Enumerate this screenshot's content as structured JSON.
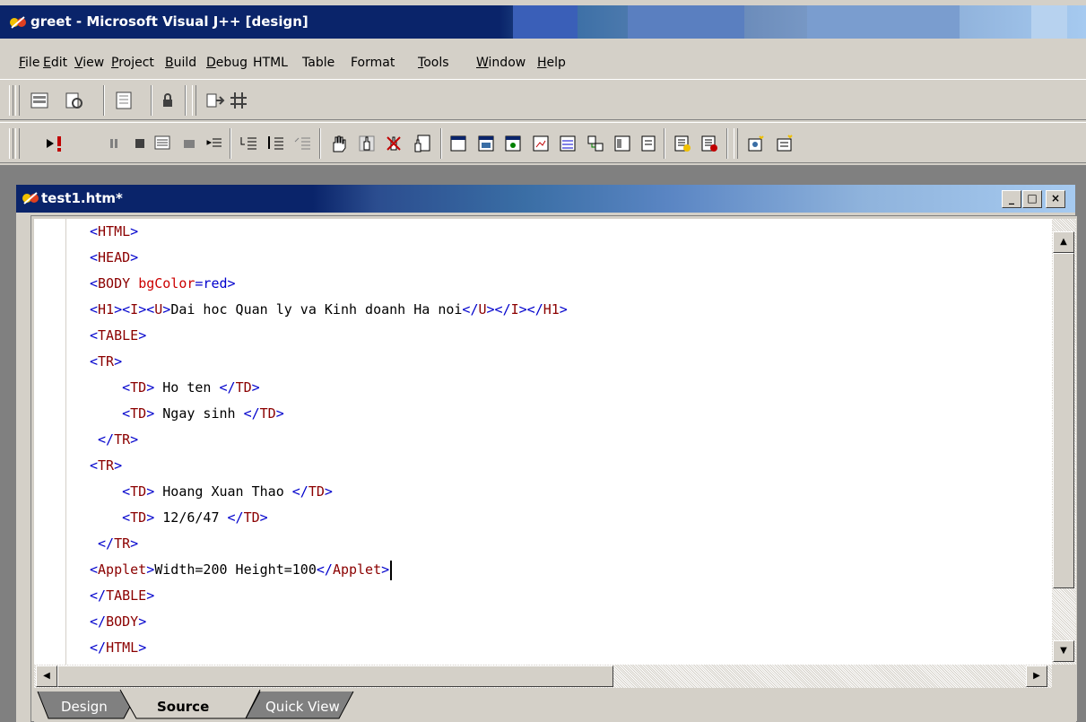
{
  "app": {
    "title": "greet - Microsoft Visual J++ [design]"
  },
  "menu": [
    {
      "label": "File",
      "u": "F",
      "rest": "ile"
    },
    {
      "label": "Edit",
      "u": "E",
      "rest": "dit"
    },
    {
      "label": "View",
      "u": "V",
      "rest": "iew"
    },
    {
      "label": "Project",
      "u": "P",
      "rest": "roject"
    },
    {
      "label": "Build",
      "u": "B",
      "rest": "uild"
    },
    {
      "label": "Debug",
      "u": "D",
      "rest": "ebug"
    },
    {
      "label": "HTML",
      "u": "",
      "rest": "HTML"
    },
    {
      "label": "Table",
      "u": "",
      "rest": "Table"
    },
    {
      "label": "Format",
      "u": "",
      "rest": "Format"
    },
    {
      "label": "Tools",
      "u": "T",
      "rest": "ools"
    },
    {
      "label": "Window",
      "u": "W",
      "rest": "indow"
    },
    {
      "label": "Help",
      "u": "H",
      "rest": "elp"
    }
  ],
  "document": {
    "title": "test1.htm*",
    "minimize_label": "_",
    "maximize_label": "□",
    "close_label": "×"
  },
  "code_lines": [
    {
      "text": "<HTML>"
    },
    {
      "text": "<HEAD>"
    },
    {
      "text": "<BODY bgColor=red>"
    },
    {
      "text": "<H1><I><U>Dai hoc Quan ly va Kinh doanh Ha noi</U></I></H1>"
    },
    {
      "text": "<TABLE>"
    },
    {
      "text": "<TR>"
    },
    {
      "text": "    <TD> Ho ten </TD>"
    },
    {
      "text": "    <TD> Ngay sinh </TD>"
    },
    {
      "text": " </TR>"
    },
    {
      "text": "<TR>"
    },
    {
      "text": "    <TD> Hoang Xuan Thao </TD>"
    },
    {
      "text": "    <TD> 12/6/47 </TD>"
    },
    {
      "text": " </TR>"
    },
    {
      "text": "<Applet>Width=200 Height=100</Applet>"
    },
    {
      "text": "</TABLE>"
    },
    {
      "text": "</BODY>"
    },
    {
      "text": "</HTML>"
    }
  ],
  "tabs": [
    {
      "label": "Design",
      "active": false
    },
    {
      "label": "Source",
      "active": true
    },
    {
      "label": "Quick View",
      "active": false
    }
  ],
  "toolbar_icons": [
    "layout-icon",
    "refresh-page-icon",
    "page-icon",
    "lock-icon",
    "form-icon",
    "grid-icon",
    "run-icon",
    "exclamation-icon",
    "pause-icon",
    "stop-icon",
    "step-icon",
    "breakpoint-icon",
    "indent-icon",
    "step-into-icon",
    "step-over-icon",
    "step-out-icon",
    "hand-icon",
    "hand-pointer-icon",
    "hand-cross-icon",
    "hand-doc-icon",
    "watch-icon",
    "locals-icon",
    "auto-icon",
    "call-stack-icon",
    "threads-icon",
    "modules-icon",
    "memory-icon",
    "registers-icon",
    "disasm-icon",
    "clear-icon",
    "script-icon",
    "object-icon"
  ]
}
